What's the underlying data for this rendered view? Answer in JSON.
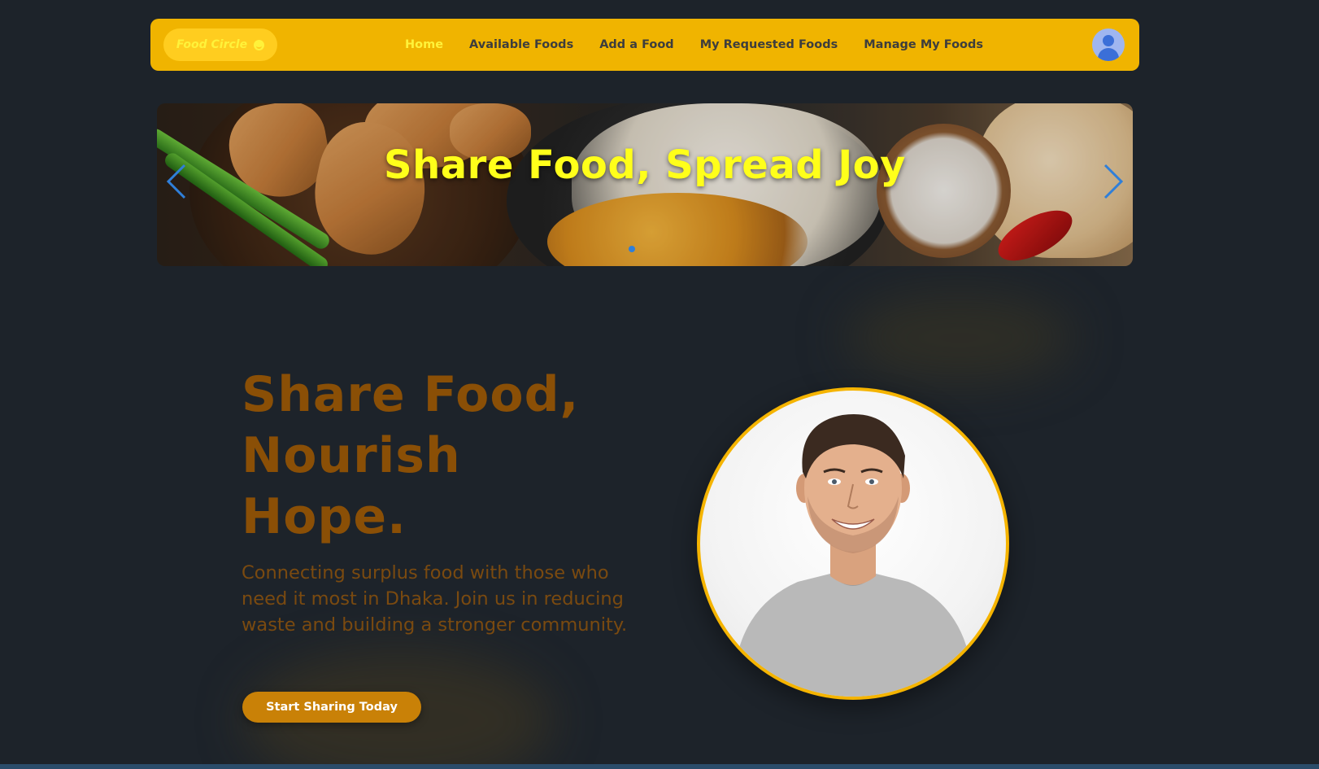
{
  "navbar": {
    "brand": "Food Circle",
    "brand_icon": "smile-icon",
    "links": [
      "Home",
      "Available Foods",
      "Add a Food",
      "My Requested Foods",
      "Manage My Foods"
    ],
    "active_link": "Home",
    "avatar_icon": "user-avatar-icon"
  },
  "carousel": {
    "title": "Share Food, Spread Joy",
    "prev_icon": "chevron-left-icon",
    "next_icon": "chevron-right-icon"
  },
  "hero": {
    "title_lines": [
      "Share Food,",
      "Nourish",
      "Hope."
    ],
    "description": "Connecting surplus food with those who need it most in Dhaka. Join us in reducing waste and building a stronger community.",
    "cta_label": "Start Sharing Today"
  },
  "colors": {
    "navbar_bg": "#f0b400",
    "page_bg": "#1d232a",
    "hero_title": "#8a4f06",
    "active_link": "#fff23a",
    "cta_bg": "#c98107",
    "portrait_border": "#f5b400"
  }
}
